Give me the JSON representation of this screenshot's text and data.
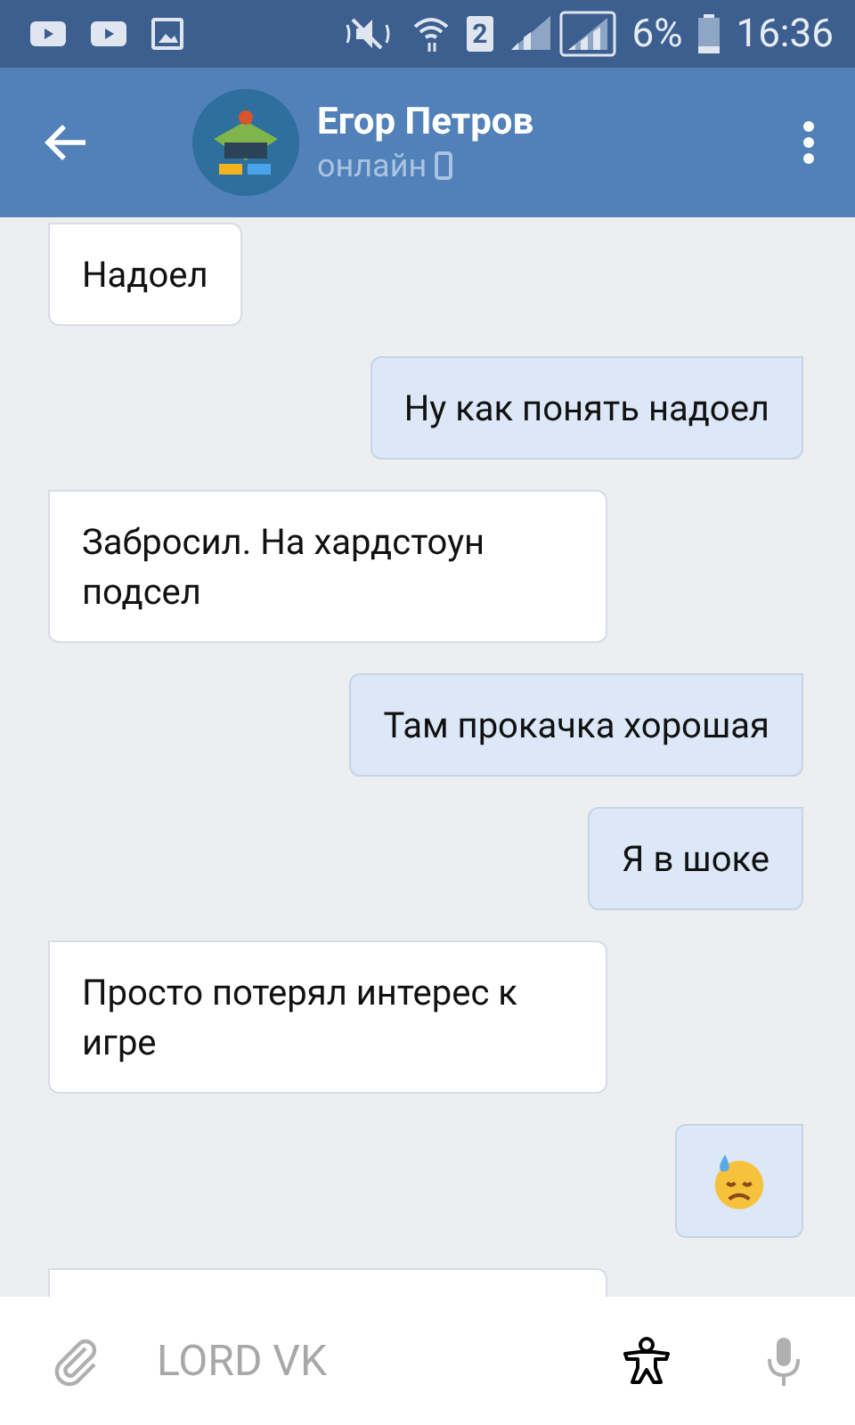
{
  "status_bar": {
    "battery": "6%",
    "time": "16:36",
    "sim": "2"
  },
  "header": {
    "name": "Егор Петров",
    "status": "онлайн"
  },
  "messages": [
    {
      "kind": "text",
      "incoming": true,
      "text": "Надоел"
    },
    {
      "kind": "text",
      "incoming": false,
      "text": "Ну как понять надоел"
    },
    {
      "kind": "text",
      "incoming": true,
      "text": "Забросил. На хардстоун подсел"
    },
    {
      "kind": "text",
      "incoming": false,
      "text": "Там прокачка хорошая"
    },
    {
      "kind": "text",
      "incoming": false,
      "text": "Я в шоке"
    },
    {
      "kind": "text",
      "incoming": true,
      "text": "Просто потерял интерес к игре"
    },
    {
      "kind": "emoji",
      "incoming": false
    },
    {
      "kind": "hidden",
      "incoming": true
    }
  ],
  "composer": {
    "placeholder": "LORD VK"
  }
}
